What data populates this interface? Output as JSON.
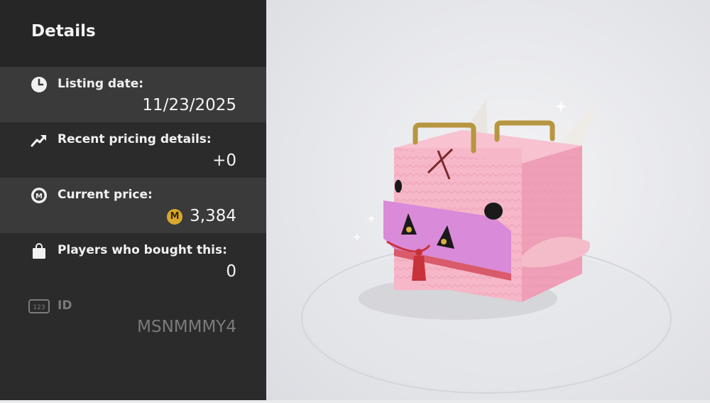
{
  "panel": {
    "title": "Details",
    "rows": [
      {
        "icon": "clock-icon",
        "label": "Listing date:",
        "value": "11/23/2025"
      },
      {
        "icon": "trend-up-icon",
        "label": "Recent pricing details:",
        "value": "+0"
      },
      {
        "icon": "medal-icon",
        "label": "Current price:",
        "value": "3,384",
        "coin_letter": "M"
      },
      {
        "icon": "shopping-bag-icon",
        "label": "Players who bought this:",
        "value": "0"
      },
      {
        "icon": "id-123-icon",
        "icon_text": "123",
        "label": "ID",
        "value": "MSNMMMY4"
      }
    ]
  },
  "colors": {
    "panel_bg": "#2b2b2b",
    "row_highlight": "#3a3a3a",
    "coin": "#d9a92c",
    "item_body": "#f6b7c8",
    "item_band": "#d98ad8"
  }
}
